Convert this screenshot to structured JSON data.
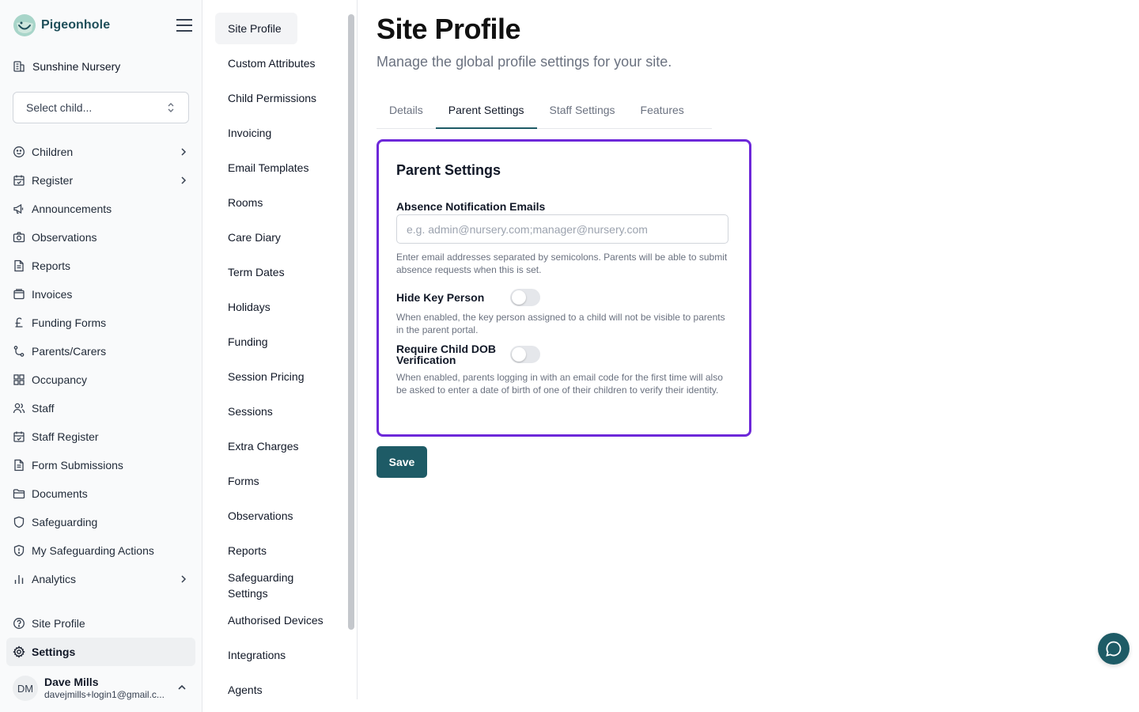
{
  "brand": {
    "name": "Pigeonhole"
  },
  "site": {
    "name": "Sunshine Nursery"
  },
  "child_select": {
    "placeholder": "Select child..."
  },
  "nav": {
    "items": [
      {
        "label": "Children",
        "icon": "smile-icon",
        "chevron": true
      },
      {
        "label": "Register",
        "icon": "calendar-check-icon",
        "chevron": true
      },
      {
        "label": "Announcements",
        "icon": "megaphone-icon",
        "chevron": false
      },
      {
        "label": "Observations",
        "icon": "camera-icon",
        "chevron": false
      },
      {
        "label": "Reports",
        "icon": "file-text-icon",
        "chevron": false
      },
      {
        "label": "Invoices",
        "icon": "wallet-icon",
        "chevron": false
      },
      {
        "label": "Funding Forms",
        "icon": "pound-icon",
        "chevron": false
      },
      {
        "label": "Parents/Carers",
        "icon": "git-branch-icon",
        "chevron": false
      },
      {
        "label": "Occupancy",
        "icon": "grid-icon",
        "chevron": false
      },
      {
        "label": "Staff",
        "icon": "users-icon",
        "chevron": false
      },
      {
        "label": "Staff Register",
        "icon": "calendar-check-icon",
        "chevron": false
      },
      {
        "label": "Form Submissions",
        "icon": "file-text-icon",
        "chevron": false
      },
      {
        "label": "Documents",
        "icon": "folder-icon",
        "chevron": false
      },
      {
        "label": "Safeguarding",
        "icon": "shield-icon",
        "chevron": false
      },
      {
        "label": "My Safeguarding Actions",
        "icon": "shield-alert-icon",
        "chevron": false
      },
      {
        "label": "Analytics",
        "icon": "bar-chart-icon",
        "chevron": true
      }
    ],
    "footer_items": [
      {
        "label": "Site Profile",
        "icon": "help-circle-icon",
        "active": false
      },
      {
        "label": "Settings",
        "icon": "gear-icon",
        "active": true
      }
    ]
  },
  "user": {
    "initials": "DM",
    "name": "Dave Mills",
    "email": "davejmills+login1@gmail.c..."
  },
  "subnav": {
    "items": [
      "Site Profile",
      "Custom Attributes",
      "Child Permissions",
      "Invoicing",
      "Email Templates",
      "Rooms",
      "Care Diary",
      "Term Dates",
      "Holidays",
      "Funding",
      "Session Pricing",
      "Sessions",
      "Extra Charges",
      "Forms",
      "Observations",
      "Reports",
      "Safeguarding Settings",
      "Authorised Devices",
      "Integrations",
      "Agents"
    ],
    "active_index": 0
  },
  "page": {
    "title": "Site Profile",
    "subtitle": "Manage the global profile settings for your site.",
    "tabs": [
      "Details",
      "Parent Settings",
      "Staff Settings",
      "Features"
    ],
    "active_tab": 1
  },
  "card": {
    "title": "Parent Settings",
    "absence": {
      "label": "Absence Notification Emails",
      "placeholder": "e.g. admin@nursery.com;manager@nursery.com",
      "value": "",
      "help": "Enter email addresses separated by semicolons. Parents will be able to submit absence requests when this is set."
    },
    "hide_key_person": {
      "label": "Hide Key Person",
      "enabled": false,
      "help": "When enabled, the key person assigned to a child will not be visible to parents in the parent portal."
    },
    "require_dob": {
      "label": "Require Child DOB Verification",
      "enabled": false,
      "help": "When enabled, parents logging in with an email code for the first time will also be asked to enter a date of birth of one of their children to verify their identity."
    }
  },
  "actions": {
    "save_label": "Save"
  },
  "colors": {
    "accent": "#1e5b66",
    "focus_ring": "#6d28d9",
    "brand_text": "#1f4f5a"
  }
}
